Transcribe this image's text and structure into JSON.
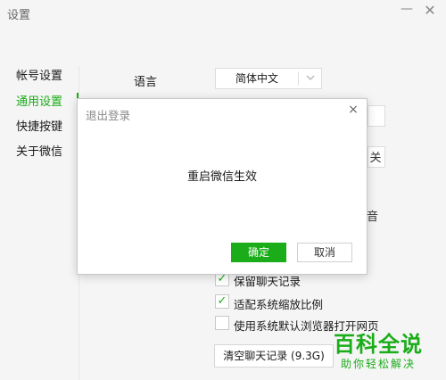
{
  "window": {
    "title": "设置",
    "minimize": "—",
    "close": "✕"
  },
  "sidebar": {
    "items": [
      {
        "label": "帐号设置"
      },
      {
        "label": "通用设置",
        "active": true
      },
      {
        "label": "快捷按键"
      },
      {
        "label": "关于微信"
      }
    ]
  },
  "settings": {
    "language_label": "语言",
    "language_value": "简体中文",
    "partial_right_1": "",
    "partial_right_2": "关",
    "partial_right_3": "音",
    "options": [
      {
        "label": "保留聊天记录",
        "checked": true
      },
      {
        "label": "适配系统缩放比例",
        "checked": true
      },
      {
        "label": "使用系统默认浏览器打开网页",
        "checked": false
      }
    ],
    "clear_button": "清空聊天记录 (9.3G)"
  },
  "dialog": {
    "title": "退出登录",
    "close": "×",
    "message": "重启微信生效",
    "ok": "确定",
    "cancel": "取消"
  },
  "watermark": {
    "main": "百科全说",
    "sub": "助你轻松解决"
  },
  "colors": {
    "accent": "#1aad19",
    "background": "#f5f5f5"
  }
}
